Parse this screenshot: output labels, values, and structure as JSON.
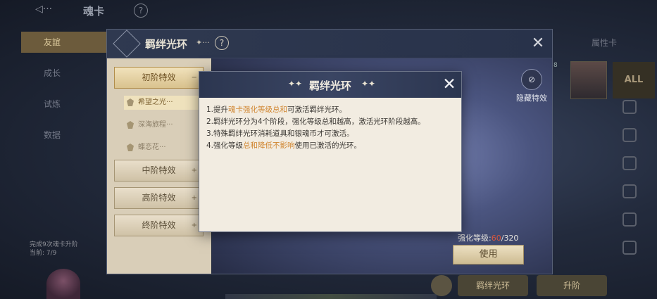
{
  "topbar": {
    "title": "魂卡",
    "help": "?"
  },
  "left_nav": [
    {
      "label": "友誼",
      "active": true
    },
    {
      "label": "成长",
      "active": false
    },
    {
      "label": "试炼",
      "active": false
    },
    {
      "label": "数据",
      "active": false
    }
  ],
  "left_status": {
    "line1": "完成9次魂卡升阶",
    "line2": "当前: 7/9"
  },
  "right_panel": {
    "title": "属性卡",
    "portrait_num": "8",
    "all_label": "ALL"
  },
  "outer_dialog": {
    "title": "羁绊光环",
    "title_dots": "✦···",
    "help": "?",
    "close": "✕",
    "tiers": [
      {
        "label": "初阶特效",
        "active": true,
        "toggle": "−"
      },
      {
        "label": "中阶特效",
        "active": false,
        "toggle": "+"
      },
      {
        "label": "高阶特效",
        "active": false,
        "toggle": "+"
      },
      {
        "label": "终阶特效",
        "active": false,
        "toggle": "+"
      }
    ],
    "sub_items": [
      {
        "label": "希望之光···",
        "active": true
      },
      {
        "label": "深海旅程···",
        "active": false
      },
      {
        "label": "蝶恋花···",
        "active": false
      }
    ],
    "hidden_effect_label": "隐藏特效",
    "enhance": {
      "label": "强化等级:",
      "current": "60",
      "separator": "/",
      "max": "320"
    },
    "use_label": "使用"
  },
  "bottom_buttons": {
    "aura_label": "羁绊光环",
    "upgrade_label": "升阶"
  },
  "modal": {
    "title": "羁绊光环",
    "spark_left": "✦✦",
    "spark_right": "✦✦",
    "close": "✕",
    "lines": [
      {
        "parts": [
          {
            "t": "1.提升",
            "h": false
          },
          {
            "t": "魂卡强化等级总和",
            "h": true
          },
          {
            "t": "可激活羁绊光环。",
            "h": false
          }
        ]
      },
      {
        "parts": [
          {
            "t": "2.羁绊光环分为4个阶段，强化等级总和越高，激活光环阶段越高。",
            "h": false
          }
        ]
      },
      {
        "parts": [
          {
            "t": "3.特殊羁绊光环消耗道具和银魂币才可激活。",
            "h": false
          }
        ]
      },
      {
        "parts": [
          {
            "t": "4.强化等级",
            "h": false
          },
          {
            "t": "总和降低不影响",
            "h": true
          },
          {
            "t": "使用已激活的光环。",
            "h": false
          }
        ]
      }
    ]
  }
}
